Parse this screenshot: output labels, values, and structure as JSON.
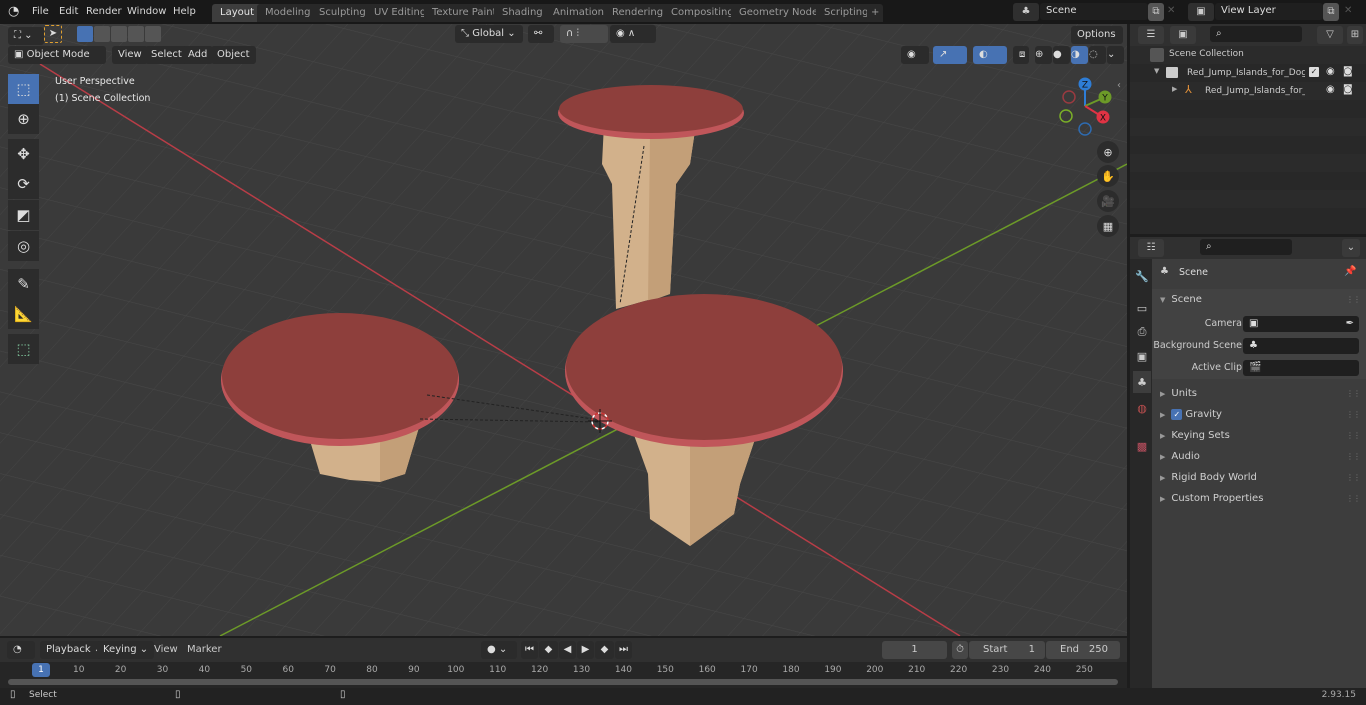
{
  "topbar": {
    "menus": [
      "File",
      "Edit",
      "Render",
      "Window",
      "Help"
    ],
    "workspaces": [
      "Layout",
      "Modeling",
      "Sculpting",
      "UV Editing",
      "Texture Paint",
      "Shading",
      "Animation",
      "Rendering",
      "Compositing",
      "Geometry Nodes",
      "Scripting"
    ],
    "active_workspace": "Layout",
    "add_workspace": "+",
    "scene": "Scene",
    "view_layer": "View Layer"
  },
  "viewport": {
    "mode": "Object Mode",
    "menus": [
      "View",
      "Select",
      "Add",
      "Object"
    ],
    "transform_orientation": "Global",
    "options_label": "Options",
    "overlay_title": "User Perspective",
    "overlay_collection": "(1) Scene Collection",
    "gizmo_axes": {
      "x": "X",
      "y": "Y",
      "z": "Z"
    },
    "colors": {
      "x_axis": "#b83d47",
      "y_axis": "#6c9a28",
      "platform_top": "#8e3f3c",
      "stem": "#d2b18b",
      "grid_bg": "#3a3a3a",
      "accent": "#4772b3"
    }
  },
  "outliner": {
    "search_placeholder": "",
    "root": "Scene Collection",
    "items": [
      {
        "label": "Red_Jump_Islands_for_Dog_P",
        "type": "collection"
      },
      {
        "label": "Red_Jump_Islands_for_Dc",
        "type": "object"
      }
    ]
  },
  "properties": {
    "context": "Scene",
    "section": "Scene",
    "fields": [
      {
        "label": "Camera",
        "value": ""
      },
      {
        "label": "Background Scene",
        "value": ""
      },
      {
        "label": "Active Clip",
        "value": ""
      }
    ],
    "panels": [
      "Units",
      "Gravity",
      "Keying Sets",
      "Audio",
      "Rigid Body World",
      "Custom Properties"
    ],
    "gravity_checked": true
  },
  "timeline": {
    "menus": [
      "Playback",
      "Keying",
      "View",
      "Marker"
    ],
    "current_frame": "1",
    "start_label": "Start",
    "start": "1",
    "end_label": "End",
    "end": "250",
    "ticks": [
      "10",
      "20",
      "30",
      "40",
      "50",
      "60",
      "70",
      "80",
      "90",
      "100",
      "110",
      "120",
      "130",
      "140",
      "150",
      "160",
      "170",
      "180",
      "190",
      "200",
      "210",
      "220",
      "230",
      "240",
      "250"
    ],
    "playhead": "1"
  },
  "statusbar": {
    "select_label": "Select",
    "version": "2.93.15"
  }
}
